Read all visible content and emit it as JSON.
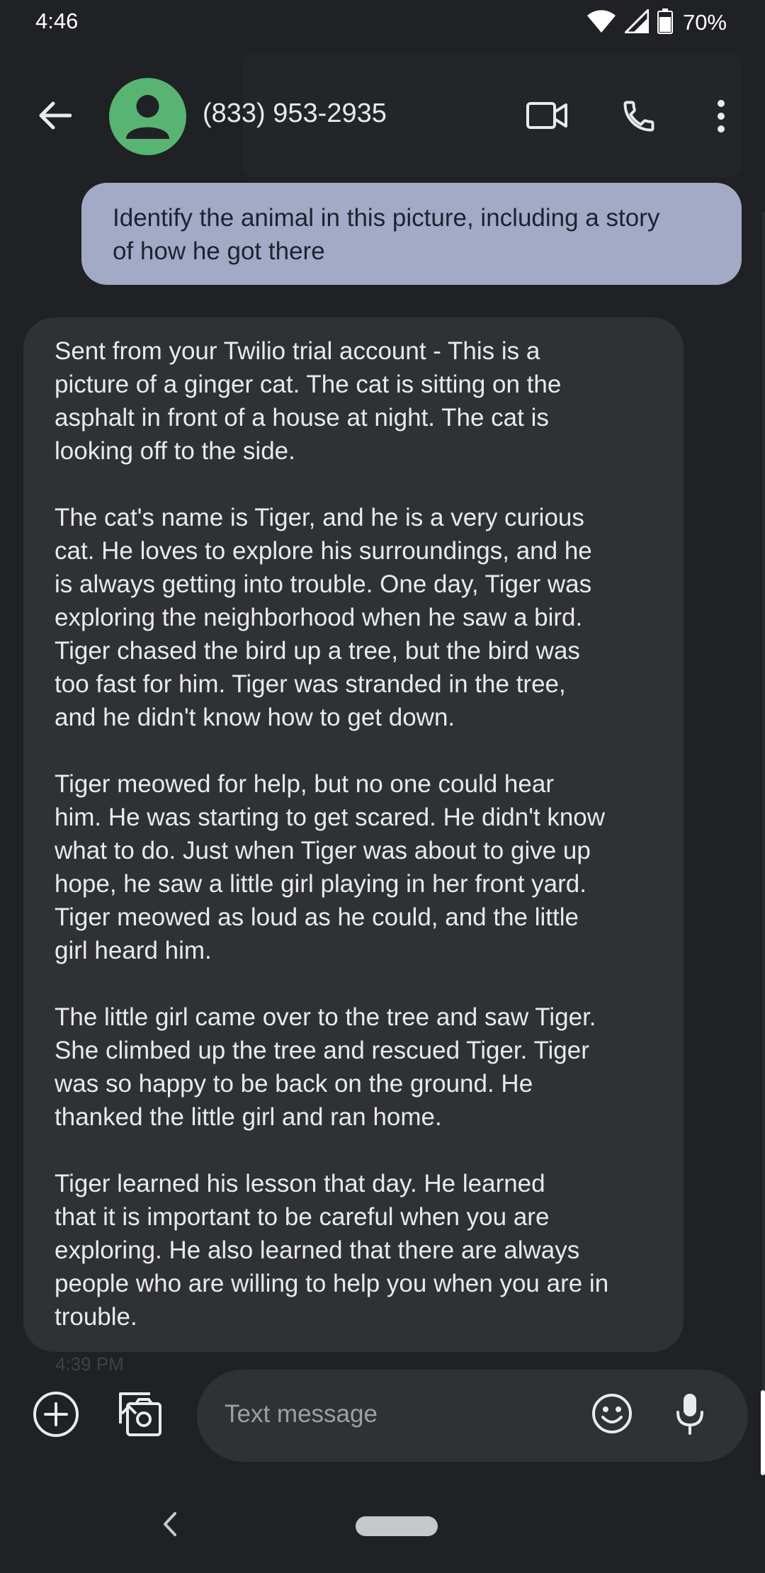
{
  "status_bar": {
    "time": "4:46",
    "battery": "70%",
    "icons": [
      "wifi-icon",
      "cell-signal-icon",
      "battery-icon"
    ]
  },
  "app_bar": {
    "contact_name": "(833) 953-2935",
    "icons": [
      "back-arrow-icon",
      "avatar-person-icon",
      "video-call-icon",
      "phone-icon",
      "more-vert-icon"
    ]
  },
  "conversation": {
    "outgoing": {
      "lines": [
        "Identify the animal in this picture, including a story",
        "of how he got there"
      ]
    },
    "incoming": {
      "paragraphs": [
        "Sent from your Twilio trial account - This is a\npicture of a ginger cat. The cat is sitting on the\nasphalt in front of a house at night. The cat is\nlooking off to the side.",
        "The cat's name is Tiger, and he is a very curious\ncat. He loves to explore his surroundings, and he\nis always getting into trouble. One day, Tiger was\nexploring the neighborhood when he saw a bird.\nTiger chased the bird up a tree, but the bird was\ntoo fast for him. Tiger was stranded in the tree,\nand he didn't know how to get down.",
        "Tiger meowed for help, but no one could hear\nhim. He was starting to get scared. He didn't know\nwhat to do. Just when Tiger was about to give up\nhope, he saw a little girl playing in her front yard.\nTiger meowed as loud as he could, and the little\ngirl heard him.",
        "The little girl came over to the tree and saw Tiger.\nShe climbed up the tree and rescued Tiger. Tiger\nwas so happy to be back on the ground. He\nthanked the little girl and ran home.",
        "Tiger learned his lesson that day. He learned\nthat it is important to be careful when you are\nexploring. He also learned that there are always\npeople who are willing to help you when you are in\ntrouble."
      ],
      "timestamp": "4:39 PM"
    }
  },
  "compose": {
    "placeholder": "Text message",
    "icons": [
      "add-circle-icon",
      "gallery-camera-icon",
      "emoji-icon",
      "microphone-icon"
    ]
  },
  "navigation": {
    "icons": [
      "nav-back-icon",
      "home-pill-icon"
    ]
  },
  "colors": {
    "background": "#202124",
    "outgoing_bubble": "#a3aac6",
    "incoming_bubble": "#303134",
    "avatar": "#57b472",
    "text": "#e8eaed",
    "placeholder": "#9aa0a6"
  }
}
